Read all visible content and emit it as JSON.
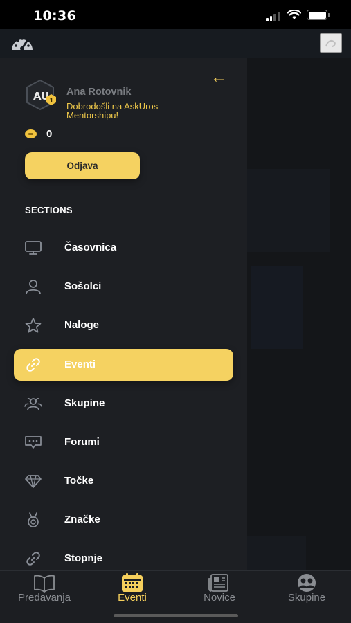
{
  "status_bar": {
    "time": "10:36"
  },
  "drawer": {
    "user_name": "Ana Rotovnik",
    "welcome_text": "Dobrodošli na AskUros Mentorshipu!",
    "avatar_initials": "AU",
    "avatar_badge": "1",
    "coins": "0",
    "logout_label": "Odjava",
    "sections_title": "SECTIONS",
    "items": [
      {
        "label": "Časovnica",
        "icon": "monitor-icon"
      },
      {
        "label": "Sošolci",
        "icon": "user-icon"
      },
      {
        "label": "Naloge",
        "icon": "star-icon"
      },
      {
        "label": "Eventi",
        "icon": "link-icon",
        "active": true
      },
      {
        "label": "Skupine",
        "icon": "group-icon"
      },
      {
        "label": "Forumi",
        "icon": "chat-icon"
      },
      {
        "label": "Točke",
        "icon": "diamond-icon"
      },
      {
        "label": "Značke",
        "icon": "medal-icon"
      },
      {
        "label": "Stopnje",
        "icon": "link-icon"
      }
    ]
  },
  "tabbar": {
    "tabs": [
      {
        "label": "Predavanja",
        "icon": "book-icon"
      },
      {
        "label": "Eventi",
        "icon": "calendar-icon",
        "active": true
      },
      {
        "label": "Novice",
        "icon": "newspaper-icon"
      },
      {
        "label": "Skupine",
        "icon": "people-icon"
      }
    ]
  },
  "colors": {
    "accent": "#f5d261",
    "drawer_bg": "#1d1f23",
    "tab_active": "#f5cf5c",
    "tab_inactive": "#8a8d92"
  }
}
